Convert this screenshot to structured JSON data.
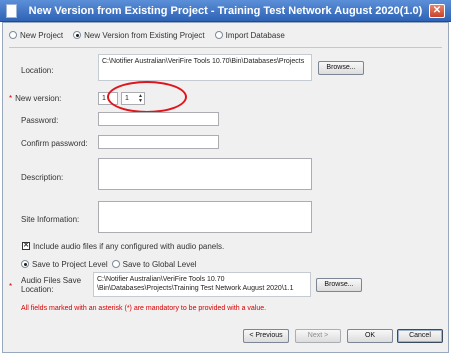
{
  "window": {
    "title": "New Version from Existing Project - Training Test Network August 2020(1.0)",
    "close_glyph": "✕"
  },
  "mode": {
    "options": [
      {
        "label": "New Project",
        "selected": false
      },
      {
        "label": "New Version from Existing Project",
        "selected": true
      },
      {
        "label": "Import Database",
        "selected": false
      }
    ]
  },
  "form": {
    "location_label": "Location:",
    "location_value": "C:\\Notifier Australian\\VeriFire Tools 10.70\\Bin\\Databases\\Projects",
    "browse_label": "Browse...",
    "required_mark": "*",
    "new_version_label": "New version:",
    "version_major": "1",
    "version_minor": "1",
    "spin_up": "▲",
    "spin_down": "▼",
    "password_label": "Password:",
    "password_value": "",
    "confirm_password_label": "Confirm password:",
    "confirm_password_value": "",
    "description_label": "Description:",
    "description_value": "",
    "site_info_label": "Site Information:",
    "site_info_value": "",
    "include_audio_label": "Include audio files if any configured with audio panels.",
    "include_audio_checked": true,
    "include_audio_mark": "✕",
    "save_level_options": [
      {
        "label": "Save to Project Level",
        "selected": true
      },
      {
        "label": "Save to Global Level",
        "selected": false
      }
    ],
    "audio_save_label": "Audio Files Save Location:",
    "audio_save_value": "C:\\Notifier Australian\\VeriFire Tools 10.70\n\\Bin\\Databases\\Projects\\Training Test Network August 2020\\1.1",
    "audio_browse_label": "Browse...",
    "mandatory_note": "All fields marked with an asterisk (*) are mandatory to be provided with a value."
  },
  "buttons": {
    "previous": "< Previous",
    "next": "Next >",
    "ok": "OK",
    "cancel": "Cancel"
  },
  "colors": {
    "title_bar": "#2f63b5",
    "required": "#d40000",
    "highlight": "#e0141b"
  }
}
